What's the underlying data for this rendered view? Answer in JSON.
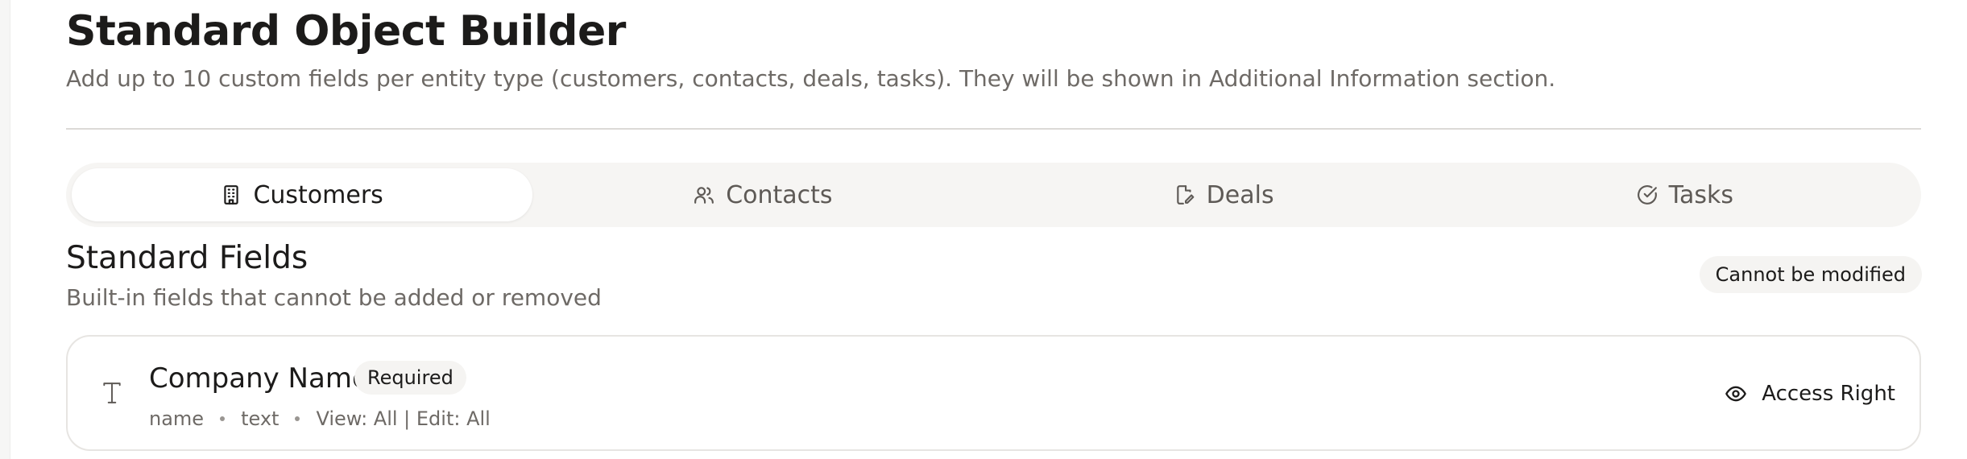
{
  "header": {
    "title": "Standard Object Builder",
    "subtitle": "Add up to 10 custom fields per entity type (customers, contacts, deals, tasks). They will be shown in Additional Information section."
  },
  "tabs": [
    {
      "label": "Customers",
      "icon": "building-icon",
      "active": true
    },
    {
      "label": "Contacts",
      "icon": "users-icon",
      "active": false
    },
    {
      "label": "Deals",
      "icon": "file-edit-icon",
      "active": false
    },
    {
      "label": "Tasks",
      "icon": "check-circle-icon",
      "active": false
    }
  ],
  "standard_fields": {
    "title": "Standard Fields",
    "subtitle": "Built-in fields that cannot be added or removed",
    "badge": "Cannot be modified",
    "fields": [
      {
        "type_icon": "text-type-icon",
        "name": "Company Name",
        "badge": "Required",
        "key": "name",
        "data_type": "text",
        "permissions": "View: All | Edit: All",
        "action_label": "Access Right",
        "action_icon": "eye-icon"
      }
    ]
  },
  "colors": {
    "text": "#1c1b1a",
    "muted": "#6e6a66",
    "tab_bg": "#f6f5f3",
    "border": "#e7e5e2"
  }
}
